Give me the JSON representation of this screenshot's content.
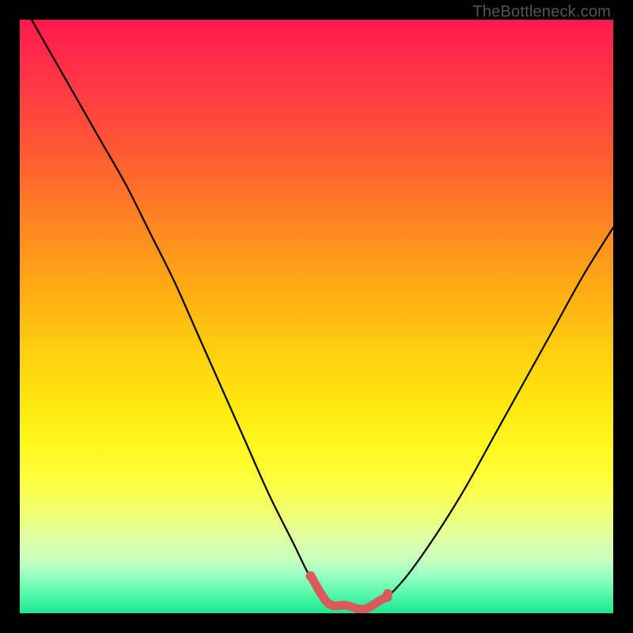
{
  "watermark": "TheBottleneck.com",
  "colors": {
    "frame": "#000000",
    "curve": "#000000",
    "overlay_marker": "#d95a5a",
    "gradient_top": "#ff1a4d",
    "gradient_bottom": "#1ae890"
  },
  "chart_data": {
    "type": "line",
    "title": "",
    "xlabel": "",
    "ylabel": "",
    "xlim": [
      0,
      100
    ],
    "ylim": [
      0,
      100
    ],
    "grid": false,
    "legend": false,
    "series": [
      {
        "name": "bottleneck-curve",
        "x": [
          2,
          6,
          10,
          14,
          18,
          22,
          26,
          30,
          34,
          38,
          42,
          46,
          49,
          52,
          55,
          58,
          61,
          65,
          70,
          75,
          80,
          85,
          90,
          95,
          100
        ],
        "values": [
          100,
          93,
          86,
          79,
          72,
          64,
          56,
          47,
          38,
          29,
          20,
          12,
          6,
          2,
          1,
          1,
          2,
          6,
          13,
          21,
          30,
          39,
          48,
          57,
          65
        ]
      }
    ],
    "annotations": [
      {
        "name": "trough-marker",
        "x_range": [
          49,
          62
        ],
        "y": 1
      }
    ]
  }
}
